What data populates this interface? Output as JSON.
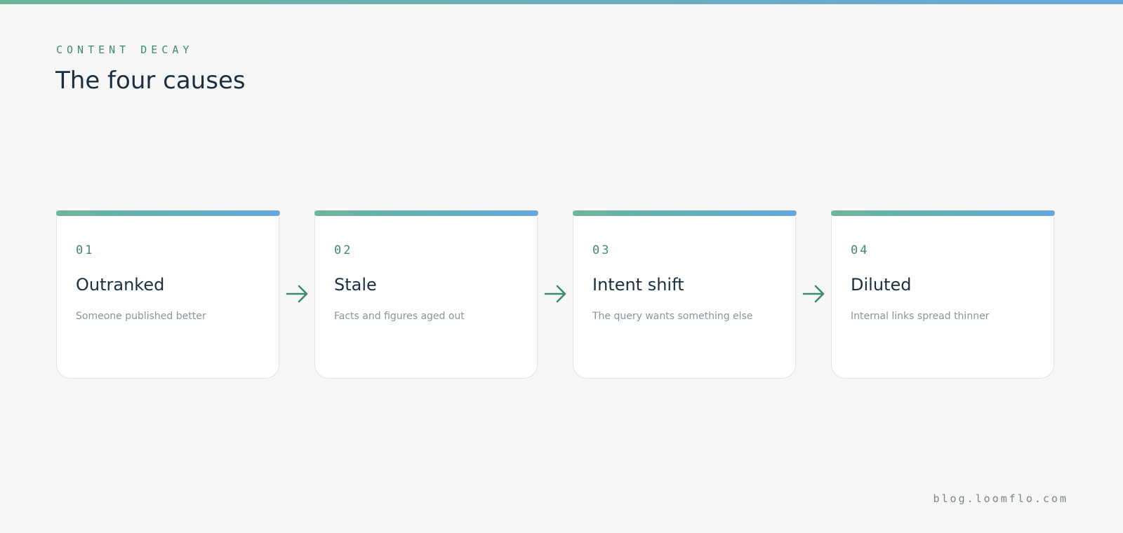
{
  "header": {
    "eyebrow": "CONTENT DECAY",
    "title": "The four causes"
  },
  "steps": [
    {
      "number": "01",
      "title": "Outranked",
      "description": "Someone published better"
    },
    {
      "number": "02",
      "title": "Stale",
      "description": "Facts and figures aged out"
    },
    {
      "number": "03",
      "title": "Intent shift",
      "description": "The query wants something else"
    },
    {
      "number": "04",
      "title": "Diluted",
      "description": "Internal links spread thinner"
    }
  ],
  "connectors": {
    "icon": "arrow-right-icon",
    "color": "#3d8a75"
  },
  "footer": {
    "url": "blog.loomflo.com"
  },
  "colors": {
    "accent_gradient_start": "#6eb59a",
    "accent_gradient_end": "#6aa7dc",
    "number_accent": "#3d8a75",
    "background": "#f6f6f4"
  }
}
